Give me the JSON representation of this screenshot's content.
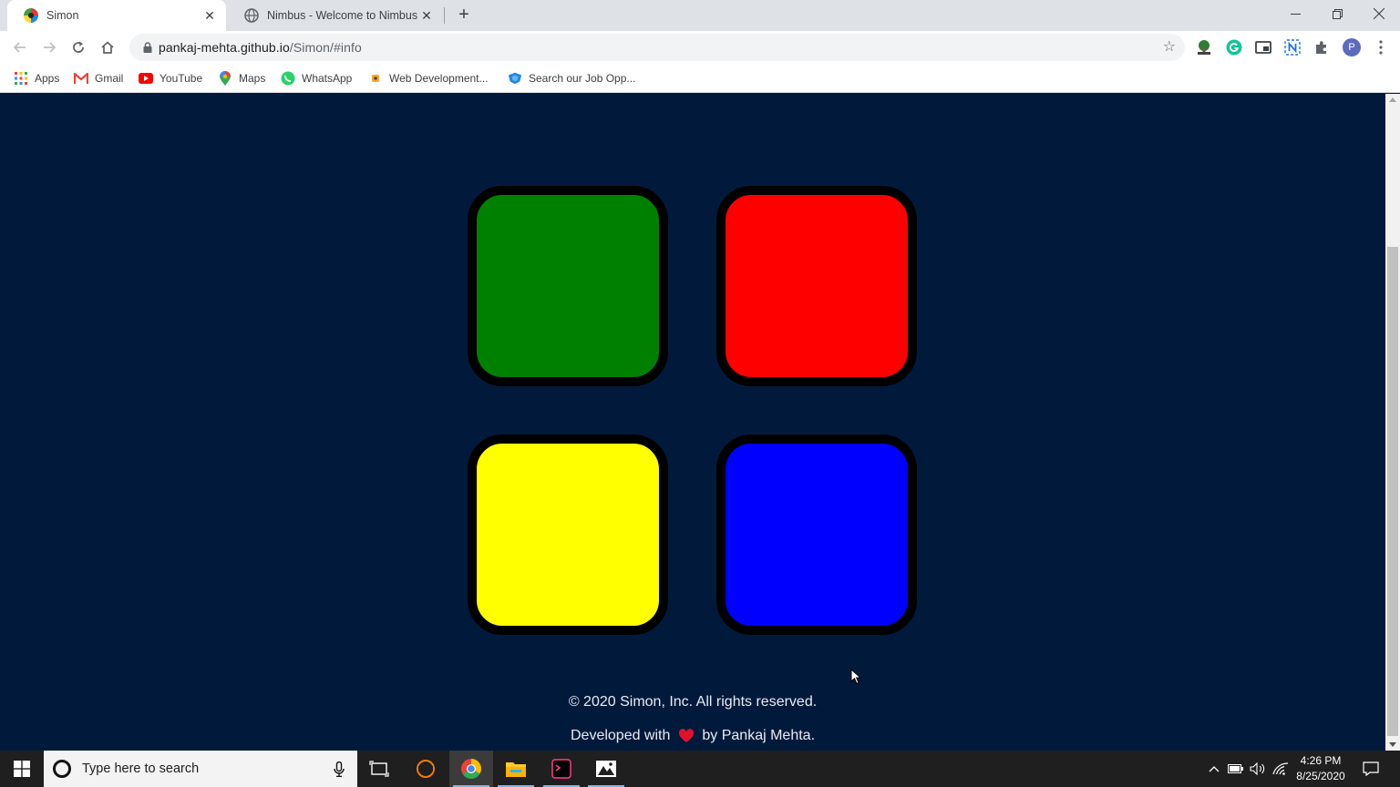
{
  "browser": {
    "tabs": [
      {
        "title": "Simon",
        "active": true
      },
      {
        "title": "Nimbus - Welcome to Nimbus Capture",
        "active": false
      }
    ],
    "url_host": "pankaj-mehta.github.io",
    "url_path": "/Simon/#info",
    "profile_initial": "P",
    "bookmarks": [
      {
        "label": "Apps",
        "icon": "apps-grid-icon"
      },
      {
        "label": "Gmail",
        "icon": "gmail-icon"
      },
      {
        "label": "YouTube",
        "icon": "youtube-icon"
      },
      {
        "label": "Maps",
        "icon": "maps-pin-icon"
      },
      {
        "label": "WhatsApp",
        "icon": "whatsapp-icon"
      },
      {
        "label": "Web Development...",
        "icon": "bookmark-favicon-icon"
      },
      {
        "label": "Search our Job Opp...",
        "icon": "job-search-icon"
      }
    ]
  },
  "game": {
    "buttons": [
      {
        "name": "green",
        "color": "#008000"
      },
      {
        "name": "red",
        "color": "#ff0000"
      },
      {
        "name": "yellow",
        "color": "#ffff00"
      },
      {
        "name": "blue",
        "color": "#0000ff"
      }
    ],
    "background": "#011a3c"
  },
  "footer": {
    "copyright": "© 2020 Simon, Inc. All rights reserved.",
    "developed_prefix": "Developed with",
    "developed_suffix": "by Pankaj Mehta."
  },
  "taskbar": {
    "search_placeholder": "Type here to search",
    "time": "4:26 PM",
    "date": "8/25/2020"
  }
}
